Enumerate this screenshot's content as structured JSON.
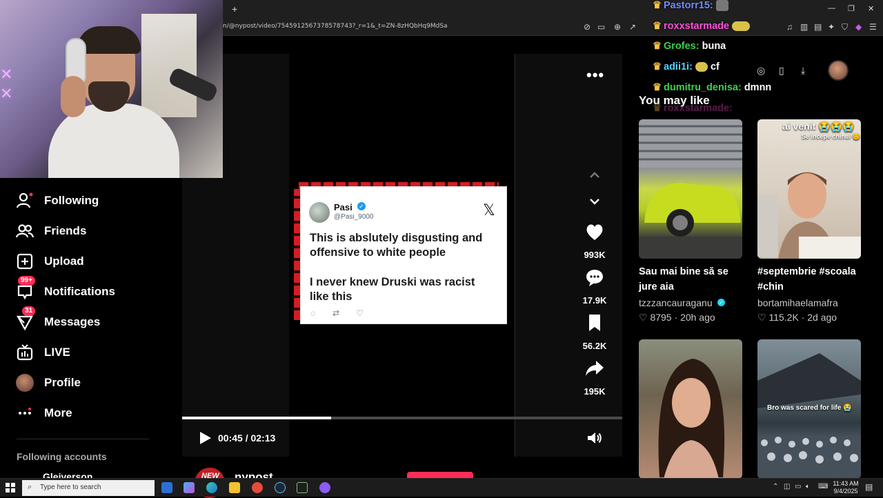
{
  "browser": {
    "url": "n/@nypost/video/7545912567378578743?_r=1&_t=ZN-8zHQbHq9MdSa",
    "new_tab": "+"
  },
  "chat": [
    {
      "badges": "👑",
      "user": "Pastorr15:",
      "user_color": "#6f8cff",
      "message": ""
    },
    {
      "badges": "👑",
      "user": "roxxstarmade",
      "user_color": "#ff4fd8",
      "message": ""
    },
    {
      "badges": "👑",
      "user": "Grofes:",
      "user_color": "#3ad14a",
      "message": "buna"
    },
    {
      "badges": "👑",
      "user": "adii1i:",
      "user_color": "#4fd1ff",
      "message": "cf"
    },
    {
      "badges": "👑",
      "user": "dumitru_denisa:",
      "user_color": "#3ad14a",
      "message": "dmnn"
    },
    {
      "badges": "👑",
      "user": "roxxstarmade:",
      "user_color": "#ff4fd8",
      "message": ""
    }
  ],
  "sidebar": {
    "items": [
      {
        "label": "Following",
        "icon": "following-icon"
      },
      {
        "label": "Friends",
        "icon": "friends-icon"
      },
      {
        "label": "Upload",
        "icon": "upload-icon"
      },
      {
        "label": "Notifications",
        "icon": "notifications-icon",
        "badge": "99+"
      },
      {
        "label": "Messages",
        "icon": "messages-icon",
        "badge": "31"
      },
      {
        "label": "LIVE",
        "icon": "live-icon"
      },
      {
        "label": "Profile",
        "icon": "profile-avatar"
      },
      {
        "label": "More",
        "icon": "more-icon"
      }
    ],
    "following_accounts_title": "Following accounts",
    "following_accounts": [
      "Gleiverson"
    ]
  },
  "tweet": {
    "name": "Pasi",
    "handle": "@Pasi_9000",
    "line1": "This is abslutely disgusting and",
    "line2": "offensive to white people",
    "line3": "I never knew Druski was racist",
    "line4": "like this"
  },
  "player": {
    "current_time": "00:45",
    "duration": "02:13",
    "time_display": "00:45 / 02:13",
    "progress_fraction": 0.338
  },
  "actions": {
    "likes": "993K",
    "comments": "17.9K",
    "saves": "56.2K",
    "shares": "195K"
  },
  "channel": {
    "avatar_text": "NEW",
    "name": "nypost"
  },
  "recommendations": {
    "title": "You may like",
    "cards": [
      {
        "title": "Sau mai bine să se jure aia",
        "author": "tzzzancauraganu",
        "verified": true,
        "likes": "8795",
        "age": "20h ago",
        "overlay": ""
      },
      {
        "title": "#septembrie #scoala #chin",
        "author": "bortamihaelamafra",
        "verified": false,
        "likes": "115.2K",
        "age": "2d ago",
        "overlay": "ai venit 😭😭😭",
        "overlay2": "Se incepe chinul 😊"
      },
      {
        "title": "",
        "author": "",
        "likes": "",
        "age": "",
        "overlay": ""
      },
      {
        "title": "",
        "author": "",
        "likes": "",
        "age": "",
        "overlay": "Bro was scared for life 😭"
      }
    ]
  },
  "taskbar": {
    "search_placeholder": "Type here to search",
    "time": "11:43 AM",
    "date": "9/4/2025"
  },
  "colors": {
    "accent": "#fe2c55",
    "background": "#000000"
  }
}
